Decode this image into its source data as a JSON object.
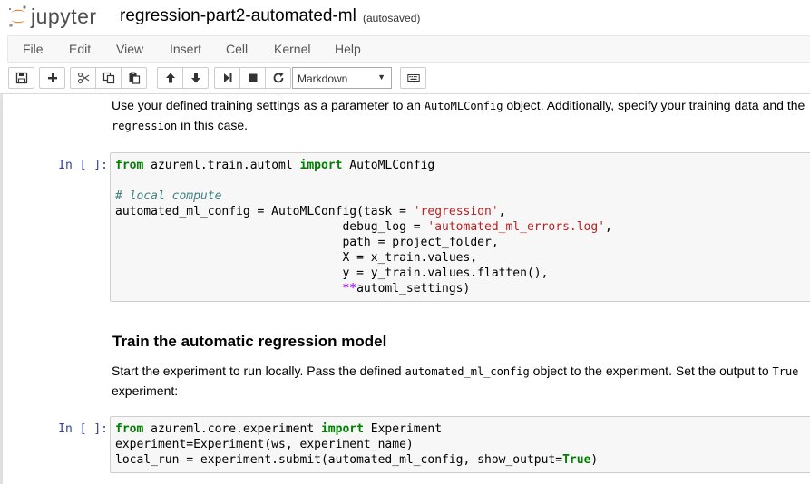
{
  "header": {
    "logo_text": "jupyter",
    "notebook_title": "regression-part2-automated-ml",
    "autosave_status": "(autosaved)"
  },
  "menu": {
    "items": [
      "File",
      "Edit",
      "View",
      "Insert",
      "Cell",
      "Kernel",
      "Help"
    ]
  },
  "toolbar": {
    "buttons": [
      {
        "name": "save",
        "icon": "floppy-icon"
      },
      {
        "name": "insert-cell-below",
        "icon": "plus-icon"
      },
      {
        "name": "cut",
        "icon": "scissors-icon"
      },
      {
        "name": "copy",
        "icon": "copy-icon"
      },
      {
        "name": "paste",
        "icon": "paste-icon"
      },
      {
        "name": "move-up",
        "icon": "arrow-up-icon"
      },
      {
        "name": "move-down",
        "icon": "arrow-down-icon"
      },
      {
        "name": "run",
        "icon": "step-forward-icon"
      },
      {
        "name": "interrupt",
        "icon": "stop-icon"
      },
      {
        "name": "restart",
        "icon": "refresh-icon"
      },
      {
        "name": "command-palette",
        "icon": "keyboard-icon"
      }
    ],
    "cell_type": "Markdown"
  },
  "cells": {
    "md1": {
      "line1_pre": "Use your defined training settings as a parameter to an ",
      "line1_code": "AutoMLConfig",
      "line1_post": " object. Additionally, specify your training data and the",
      "line2_code": "regression",
      "line2_post": " in this case."
    },
    "code1": {
      "prompt": "In [ ]:"
    },
    "heading": "Train the automatic regression model",
    "md2": {
      "line1_pre": "Start the experiment to run locally. Pass the defined ",
      "line1_code": "automated_ml_config",
      "line1_post": " object to the experiment. Set the output to ",
      "line1_code2": "True",
      "line2": "experiment:"
    },
    "code2": {
      "prompt": "In [ ]:"
    }
  },
  "colors": {
    "keyword": "#008000",
    "string": "#ba2121",
    "comment": "#408080",
    "operator": "#aa22ff",
    "prompt": "#303f9f",
    "logo_orange": "#f37726"
  }
}
